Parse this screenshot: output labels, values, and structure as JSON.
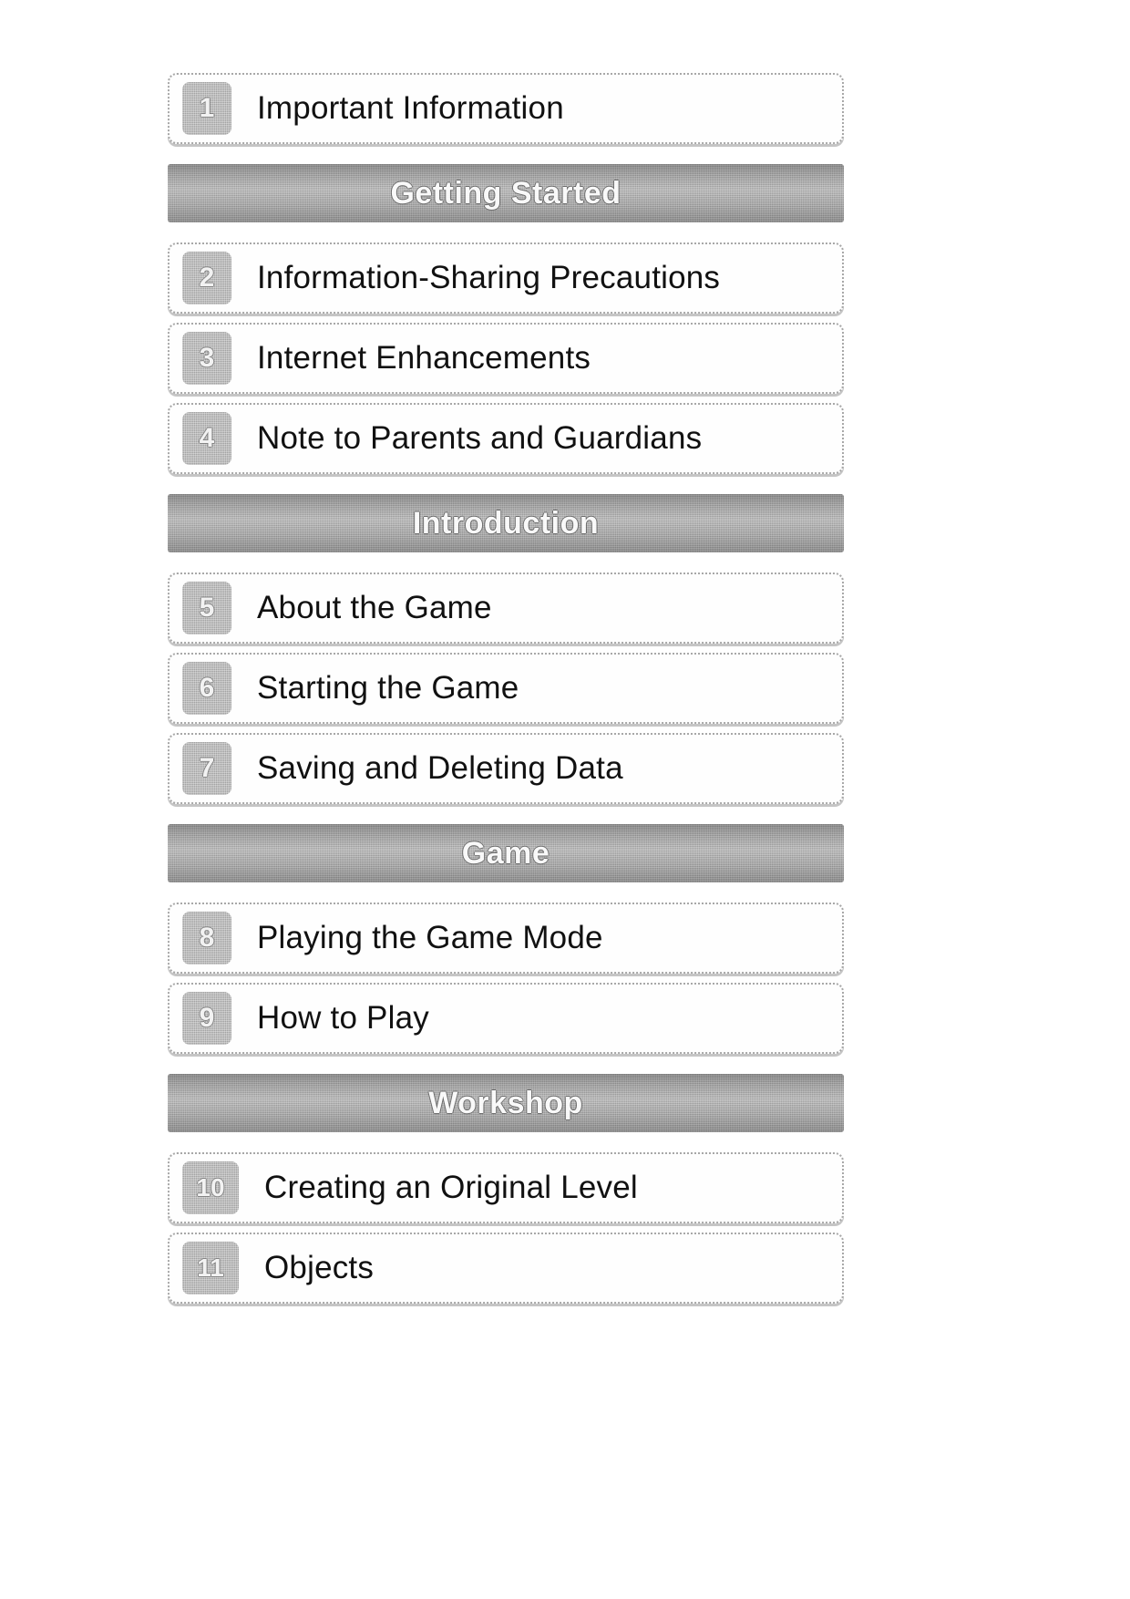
{
  "document": {
    "kind": "electronic-manual-table-of-contents",
    "colors": {
      "page_background": "#ffffff",
      "card_background": "#fefefe",
      "card_border": "#a8a8a8",
      "badge_fill": "#a2a2a2",
      "section_header_fill": "#9a9a9a",
      "section_header_text": "#ffffff",
      "entry_text": "#111111"
    }
  },
  "blocks": [
    {
      "type": "entry",
      "name": "entry-important-information",
      "number": "1",
      "label": "Important Information",
      "wide_badge": false
    },
    {
      "type": "section",
      "name": "section-getting-started",
      "title": "Getting Started"
    },
    {
      "type": "entry",
      "name": "entry-information-sharing-precautions",
      "number": "2",
      "label": "Information-Sharing Precautions",
      "wide_badge": false
    },
    {
      "type": "entry",
      "name": "entry-internet-enhancements",
      "number": "3",
      "label": "Internet Enhancements",
      "wide_badge": false
    },
    {
      "type": "entry",
      "name": "entry-note-to-parents-and-guardians",
      "number": "4",
      "label": "Note to Parents and Guardians",
      "wide_badge": false
    },
    {
      "type": "section",
      "name": "section-introduction",
      "title": "Introduction"
    },
    {
      "type": "entry",
      "name": "entry-about-the-game",
      "number": "5",
      "label": "About the Game",
      "wide_badge": false
    },
    {
      "type": "entry",
      "name": "entry-starting-the-game",
      "number": "6",
      "label": "Starting the Game",
      "wide_badge": false
    },
    {
      "type": "entry",
      "name": "entry-saving-and-deleting-data",
      "number": "7",
      "label": "Saving and Deleting Data",
      "wide_badge": false
    },
    {
      "type": "section",
      "name": "section-game",
      "title": "Game"
    },
    {
      "type": "entry",
      "name": "entry-playing-the-game-mode",
      "number": "8",
      "label": "Playing the Game Mode",
      "wide_badge": false
    },
    {
      "type": "entry",
      "name": "entry-how-to-play",
      "number": "9",
      "label": "How to Play",
      "wide_badge": false
    },
    {
      "type": "section",
      "name": "section-workshop",
      "title": "Workshop"
    },
    {
      "type": "entry",
      "name": "entry-creating-an-original-level",
      "number": "10",
      "label": "Creating an Original Level",
      "wide_badge": true
    },
    {
      "type": "entry",
      "name": "entry-objects",
      "number": "11",
      "label": "Objects",
      "wide_badge": true
    }
  ]
}
